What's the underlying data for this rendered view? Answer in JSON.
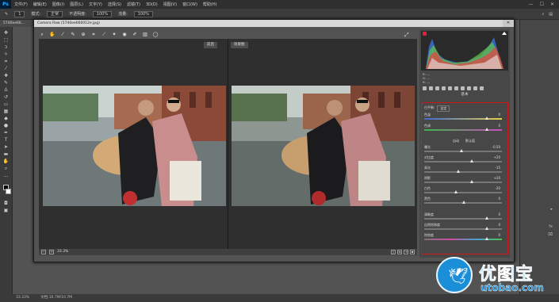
{
  "app": {
    "logo": "Ps",
    "menu": [
      "文件(F)",
      "编辑(E)",
      "图像(I)",
      "图层(L)",
      "文字(Y)",
      "选择(S)",
      "滤镜(T)",
      "3D(D)",
      "视图(V)",
      "窗口(W)",
      "帮助(H)"
    ],
    "window_controls": [
      "—",
      "☐",
      "✕"
    ]
  },
  "options_bar": {
    "size": "1",
    "mode_label": "模式:",
    "mode": "正常",
    "opacity_label": "不透明度:",
    "opacity": "100%",
    "flow_label": "流量:",
    "flow": "100%"
  },
  "document_tab": "5740ee66...",
  "status_bar": {
    "zoom": "33.33%",
    "doc": "文档:10.7M/10.7M"
  },
  "camera_raw": {
    "title": "Camera Raw (5740ee660012e.jpg)",
    "close": "✕",
    "before_label": "前后",
    "after_label": "效果图",
    "zoom": "33.3%",
    "histogram": {
      "r_label": "R:",
      "g_label": "G:",
      "b_label": "B:",
      "r": "---",
      "g": "---",
      "b": "---"
    },
    "panel_title": "基本",
    "white_balance_label": "白平衡:",
    "white_balance": "自定",
    "auto_label": "自动",
    "default_label": "默认值",
    "sliders": [
      {
        "label": "色温",
        "value": "0"
      },
      {
        "label": "色调",
        "value": "0"
      },
      {
        "label": "曝光",
        "value": "-0.50"
      },
      {
        "label": "对比度",
        "value": "+20"
      },
      {
        "label": "高光",
        "value": "-15"
      },
      {
        "label": "阴影",
        "value": "+20"
      },
      {
        "label": "白色",
        "value": "-20"
      },
      {
        "label": "黑色",
        "value": "0"
      },
      {
        "label": "清晰度",
        "value": "0"
      },
      {
        "label": "自然饱和度",
        "value": "0"
      },
      {
        "label": "饱和度",
        "value": "0"
      }
    ]
  },
  "watermark": {
    "cn": "优图宝",
    "en": "utobao.com",
    "circle_text": "微博"
  }
}
